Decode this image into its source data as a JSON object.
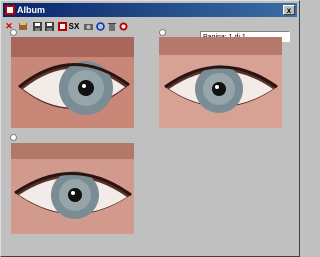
{
  "window": {
    "title": "Album",
    "close_label": "x"
  },
  "toolbar": {
    "items": [
      {
        "name": "delete-icon",
        "label": "✕",
        "color": "#d00000"
      },
      {
        "name": "card-file-icon",
        "label": ""
      },
      {
        "name": "floppy-save-icon",
        "label": ""
      },
      {
        "name": "floppy-saveas-icon",
        "label": ""
      },
      {
        "name": "sx-icon",
        "label": "SX",
        "color": "#d00000"
      },
      {
        "name": "camera-icon",
        "label": ""
      },
      {
        "name": "refresh-icon",
        "label": ""
      },
      {
        "name": "trash-icon",
        "label": ""
      },
      {
        "name": "help-icon",
        "label": ""
      }
    ],
    "page_indicator": "Pagina: 1 di 1"
  },
  "photos": [
    {
      "name": "eye-photo-1",
      "selected": false
    },
    {
      "name": "eye-photo-2",
      "selected": false
    },
    {
      "name": "eye-photo-3",
      "selected": false
    }
  ],
  "colors": {
    "skin": "#d49a8e",
    "iris": "#7a8c94",
    "sclera": "#f2ebe8"
  }
}
